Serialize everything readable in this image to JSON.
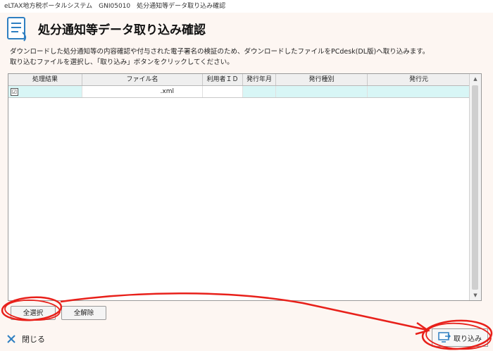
{
  "window": {
    "title": "eLTAX地方税ポータルシステム　GNI05010　処分通知等データ取り込み確認"
  },
  "page": {
    "title": "処分通知等データ取り込み確認",
    "description_line1": "ダウンロードした処分通知等の内容確認や付与された電子署名の検証のため、ダウンロードしたファイルをPCdesk(DL版)へ取り込みます。",
    "description_line2": "取り込むファイルを選択し、「取り込み」ボタンをクリックしてください。"
  },
  "table": {
    "columns": [
      "処理結果",
      "ファイル名",
      "利用者ＩＤ",
      "発行年月",
      "発行種別",
      "発行元"
    ],
    "rows": [
      {
        "checked": "☑",
        "result": "",
        "file_name": ".xml",
        "user_id": "",
        "issue_month": "",
        "issue_type": "",
        "issuer": ""
      }
    ]
  },
  "buttons": {
    "select_all": "全選択",
    "deselect_all": "全解除",
    "close": "閉じる",
    "import": "取り込み"
  },
  "colors": {
    "background": "#fdf6f2",
    "row_highlight": "#d8f6f6",
    "annotation": "#e8201a",
    "icon_blue": "#2f7fc1"
  }
}
